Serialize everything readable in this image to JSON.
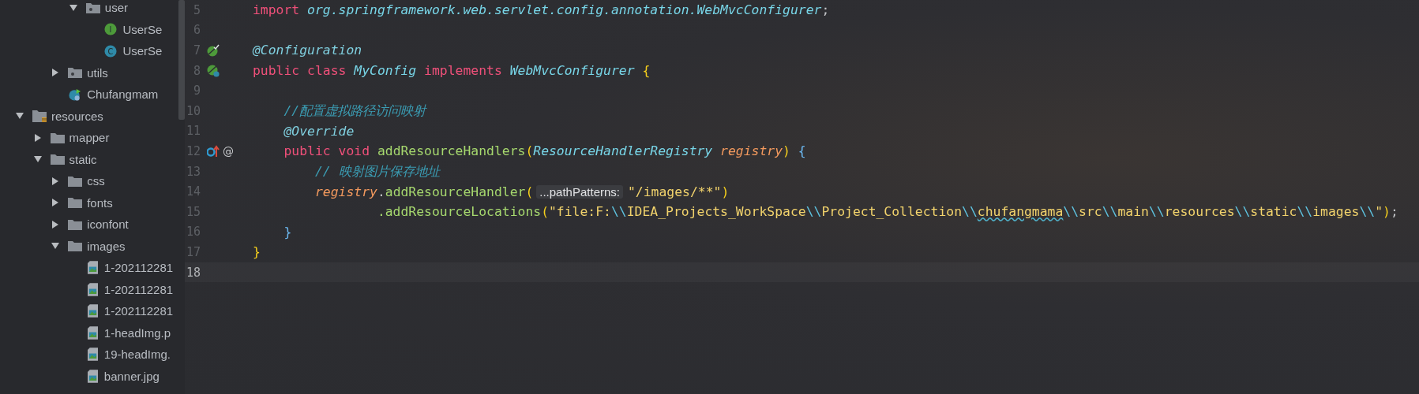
{
  "project_tree": [
    {
      "children": [
        {
          "children": [
            {
              "children": [
                {
                  "label": "user",
                  "kind": "package",
                  "expanded": true,
                  "children": [
                    {
                      "label": "UserSe",
                      "kind": "interface",
                      "badge": "I"
                    },
                    {
                      "label": "UserSe",
                      "kind": "class",
                      "badge": "C"
                    }
                  ]
                }
              ]
            },
            {
              "label": "utils",
              "kind": "package",
              "expanded": false
            },
            {
              "label": "Chufangmam",
              "kind": "boot-class"
            }
          ]
        }
      ]
    },
    {
      "label": "resources",
      "kind": "resources",
      "expanded": true,
      "children": [
        {
          "label": "mapper",
          "kind": "folder",
          "expanded": false
        },
        {
          "label": "static",
          "kind": "folder",
          "expanded": true,
          "children": [
            {
              "label": "css",
              "kind": "folder",
              "expanded": false
            },
            {
              "label": "fonts",
              "kind": "folder",
              "expanded": false
            },
            {
              "label": "iconfont",
              "kind": "folder",
              "expanded": false
            },
            {
              "label": "images",
              "kind": "folder",
              "expanded": true,
              "children": [
                {
                  "label": "1-202112281",
                  "kind": "image"
                },
                {
                  "label": "1-202112281",
                  "kind": "image"
                },
                {
                  "label": "1-202112281",
                  "kind": "image"
                },
                {
                  "label": "1-headImg.p",
                  "kind": "image"
                },
                {
                  "label": "19-headImg.",
                  "kind": "image"
                },
                {
                  "label": "banner.jpg",
                  "kind": "image"
                }
              ]
            }
          ]
        }
      ]
    }
  ],
  "editor": {
    "lines": [
      {
        "number": "5",
        "current": false,
        "tokens": [
          {
            "kind": "keyword",
            "text": "import "
          },
          {
            "kind": "type",
            "text": "org.springframework.web.servlet.config.annotation.WebMvcConfigurer"
          },
          {
            "kind": "plain",
            "text": ";"
          }
        ]
      },
      {
        "number": "6",
        "current": false
      },
      {
        "number": "7",
        "current": false,
        "gutter_icon": {
          "kind": "bean"
        },
        "tokens": [
          {
            "kind": "annotation",
            "text": "@Configuration"
          }
        ]
      },
      {
        "number": "8",
        "current": false,
        "gutter_icon": {
          "kind": "bean-config"
        },
        "tokens": [
          {
            "kind": "keyword",
            "text": "public class "
          },
          {
            "kind": "type",
            "text": "MyConfig"
          },
          {
            "kind": "keyword",
            "text": " implements "
          },
          {
            "kind": "type",
            "text": "WebMvcConfigurer"
          },
          {
            "kind": "bracket",
            "text": " {"
          }
        ]
      },
      {
        "number": "9",
        "current": false
      },
      {
        "number": "10",
        "current": false,
        "tokens": [
          {
            "kind": "comment",
            "text": "    //配置虚拟路径访问映射"
          }
        ]
      },
      {
        "number": "11",
        "current": false,
        "tokens": [
          {
            "kind": "annotation",
            "text": "    @Override"
          }
        ]
      },
      {
        "number": "12",
        "current": false,
        "gutter_icon": {
          "kind": "implements-override"
        },
        "mark_text": "@",
        "tokens": [
          {
            "kind": "keyword",
            "text": "    public void "
          },
          {
            "kind": "method",
            "text": "addResourceHandlers"
          },
          {
            "kind": "bracket",
            "text": "("
          },
          {
            "kind": "type",
            "text": "ResourceHandlerRegistry"
          },
          {
            "kind": "param",
            "text": " registry"
          },
          {
            "kind": "bracket",
            "text": ")"
          },
          {
            "kind": "bracket-inner",
            "text": " {"
          }
        ]
      },
      {
        "number": "13",
        "current": false,
        "tokens": [
          {
            "kind": "comment",
            "text": "        // 映射图片保存地址"
          }
        ]
      },
      {
        "number": "14",
        "current": false,
        "tokens": [
          {
            "kind": "param",
            "text": "        registry"
          },
          {
            "kind": "plain",
            "text": "."
          },
          {
            "kind": "method",
            "text": "addResourceHandler"
          },
          {
            "kind": "bracket",
            "text": "("
          },
          {
            "kind": "hint",
            "text": "...pathPatterns:"
          },
          {
            "kind": "string",
            "text": "\"/images/**\""
          },
          {
            "kind": "bracket",
            "text": ")"
          }
        ]
      },
      {
        "number": "15",
        "current": false,
        "tokens": [
          {
            "kind": "method",
            "text": "                .addResourceLocations"
          },
          {
            "kind": "bracket",
            "text": "("
          },
          {
            "kind": "string",
            "text": "\"file:F:"
          },
          {
            "kind": "escape",
            "text": "\\\\"
          },
          {
            "kind": "string",
            "text": "IDEA_Projects_WorkSpace"
          },
          {
            "kind": "escape",
            "text": "\\\\"
          },
          {
            "kind": "string",
            "text": "Project_Collection"
          },
          {
            "kind": "escape",
            "text": "\\\\"
          },
          {
            "kind": "typo",
            "text": "chufangmama"
          },
          {
            "kind": "escape",
            "text": "\\\\"
          },
          {
            "kind": "string",
            "text": "src"
          },
          {
            "kind": "escape",
            "text": "\\\\"
          },
          {
            "kind": "string",
            "text": "main"
          },
          {
            "kind": "escape",
            "text": "\\\\"
          },
          {
            "kind": "string",
            "text": "resources"
          },
          {
            "kind": "escape",
            "text": "\\\\"
          },
          {
            "kind": "string",
            "text": "static"
          },
          {
            "kind": "escape",
            "text": "\\\\"
          },
          {
            "kind": "string",
            "text": "images"
          },
          {
            "kind": "escape",
            "text": "\\\\"
          },
          {
            "kind": "string",
            "text": "\""
          },
          {
            "kind": "bracket",
            "text": ")"
          },
          {
            "kind": "plain",
            "text": ";"
          }
        ]
      },
      {
        "number": "16",
        "current": false,
        "tokens": [
          {
            "kind": "bracket-inner",
            "text": "    }"
          }
        ]
      },
      {
        "number": "17",
        "current": false,
        "tokens": [
          {
            "kind": "bracket",
            "text": "}"
          }
        ]
      },
      {
        "number": "18",
        "current": true
      }
    ]
  }
}
